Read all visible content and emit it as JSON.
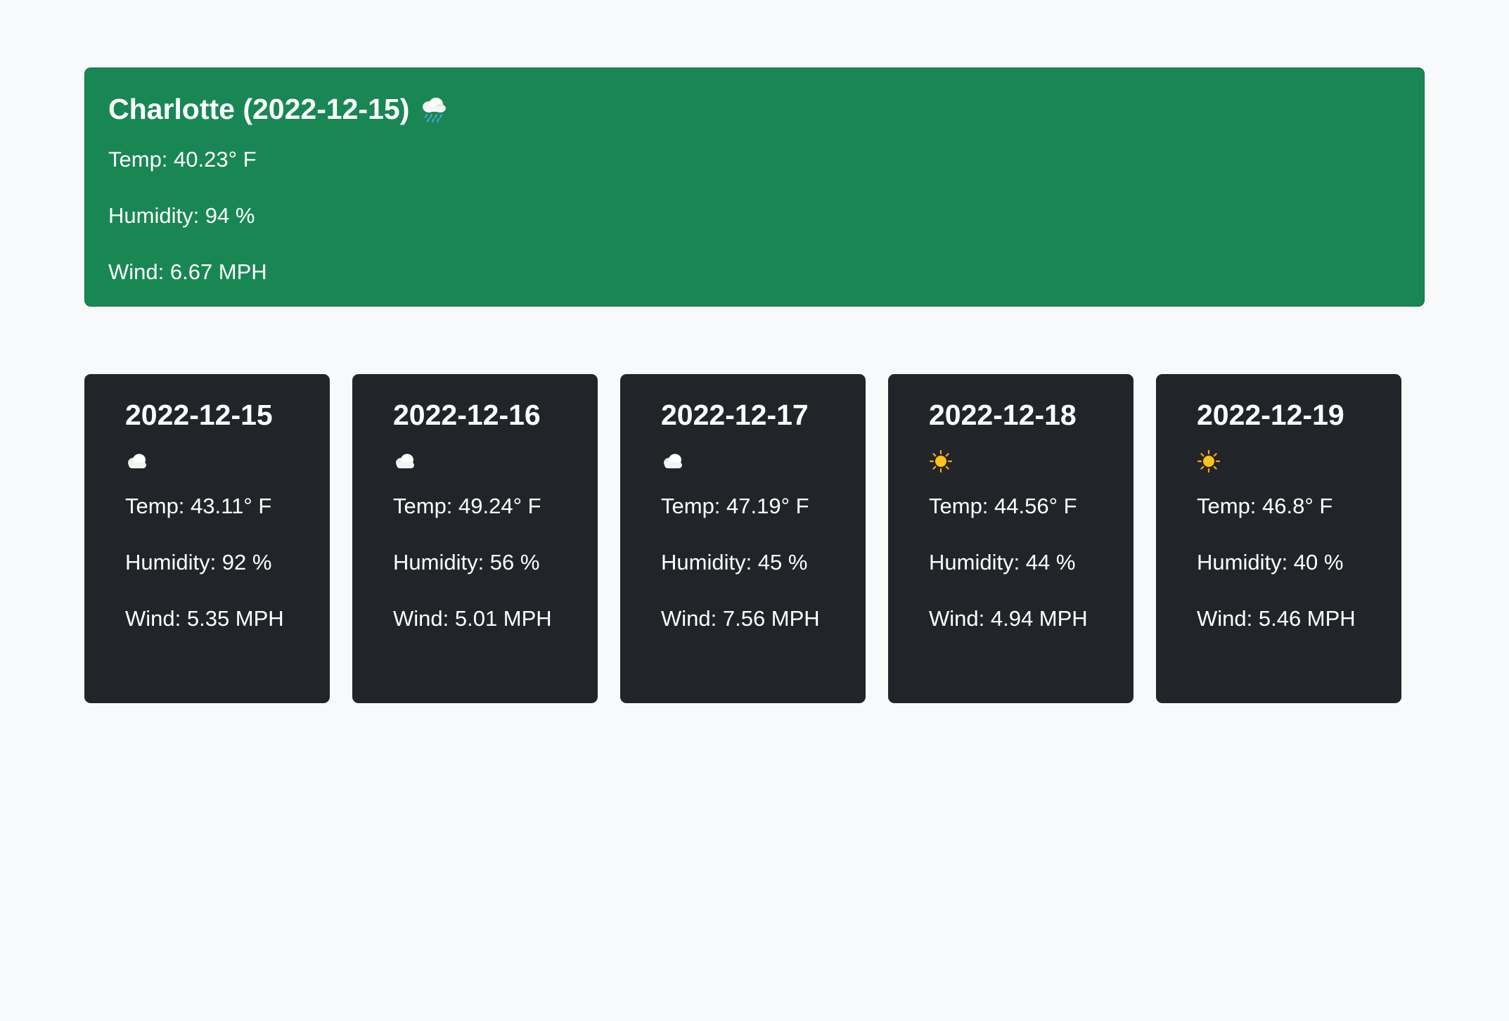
{
  "current": {
    "city_date": "Charlotte (2022-12-15)",
    "icon": "rain-cloud-icon",
    "temp": "Temp: 40.23° F",
    "humidity": "Humidity: 94 %",
    "wind": "Wind: 6.67 MPH"
  },
  "forecast": [
    {
      "date": "2022-12-15",
      "icon": "cloud-icon",
      "temp": "Temp: 43.11° F",
      "humidity": "Humidity: 92 %",
      "wind": "Wind: 5.35 MPH"
    },
    {
      "date": "2022-12-16",
      "icon": "cloud-icon",
      "temp": "Temp: 49.24° F",
      "humidity": "Humidity: 56 %",
      "wind": "Wind: 5.01 MPH"
    },
    {
      "date": "2022-12-17",
      "icon": "cloud-icon",
      "temp": "Temp: 47.19° F",
      "humidity": "Humidity: 45 %",
      "wind": "Wind: 7.56 MPH"
    },
    {
      "date": "2022-12-18",
      "icon": "sun-icon",
      "temp": "Temp: 44.56° F",
      "humidity": "Humidity: 44 %",
      "wind": "Wind: 4.94 MPH"
    },
    {
      "date": "2022-12-19",
      "icon": "sun-icon",
      "temp": "Temp: 46.8° F",
      "humidity": "Humidity: 40 %",
      "wind": "Wind: 5.46 MPH"
    }
  ],
  "colors": {
    "current_bg": "#198754",
    "card_bg": "#212529",
    "page_bg": "#f8f9fa"
  }
}
